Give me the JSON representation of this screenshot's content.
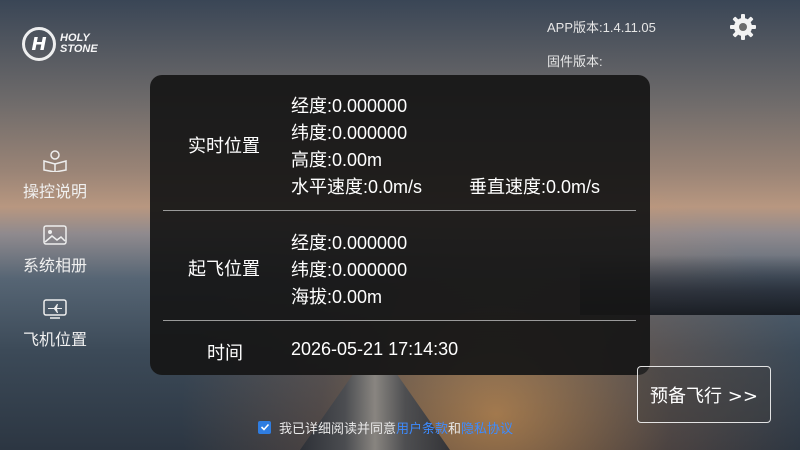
{
  "brand": {
    "logo_line1": "HOLY",
    "logo_line2": "STONE"
  },
  "header": {
    "app_version": "APP版本:1.4.11.05",
    "firmware_version": "固件版本:"
  },
  "sidebar": {
    "items": [
      {
        "label": "操控说明",
        "icon": "manual-icon"
      },
      {
        "label": "系统相册",
        "icon": "album-icon"
      },
      {
        "label": "飞机位置",
        "icon": "aircraft-position-icon"
      }
    ]
  },
  "panel": {
    "realtime": {
      "title": "实时位置",
      "longitude": "经度:0.000000",
      "latitude": "纬度:0.000000",
      "altitude": "高度:0.00m",
      "h_speed": "水平速度:0.0m/s",
      "v_speed": "垂直速度:0.0m/s"
    },
    "takeoff": {
      "title": "起飞位置",
      "longitude": "经度:0.000000",
      "latitude": "纬度:0.000000",
      "elevation": "海拔:0.00m"
    },
    "time": {
      "title": "时间",
      "value": "2026-05-21 17:14:30"
    }
  },
  "actions": {
    "fly_label": "预备飞行 >>"
  },
  "agreement": {
    "checked": true,
    "prefix": "我已详细阅读并同意",
    "terms_link": "用户条款",
    "and": "和",
    "privacy_link": "隐私协议",
    "link_color": "#3d8bff"
  }
}
